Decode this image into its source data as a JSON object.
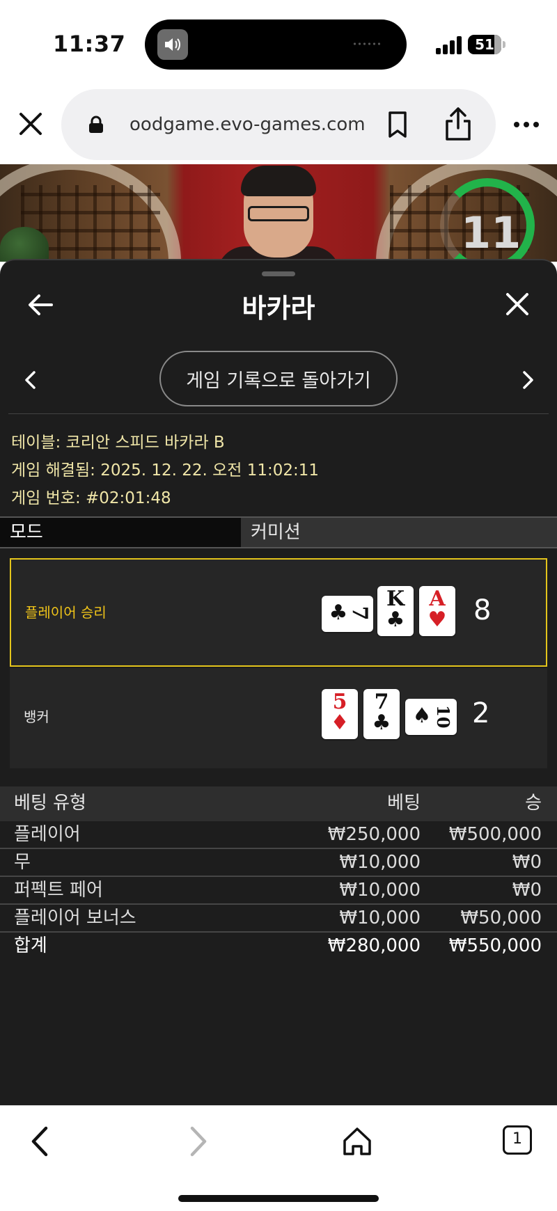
{
  "status_bar": {
    "time": "11:37",
    "battery": "51"
  },
  "browser": {
    "url": "oodgame.evo-games.com"
  },
  "video": {
    "timer": "11"
  },
  "sheet": {
    "title": "바카라",
    "history_button": "게임 기록으로 돌아가기",
    "info": {
      "table_label": "테이블:",
      "table_value": "코리안 스피드 바카라 B",
      "resolved_label": "게임 해결됨:",
      "resolved_value": "2025. 12. 22. 오전 11:02:11",
      "game_no_label": "게임 번호:",
      "game_no_value": "#02:01:48"
    },
    "mode": {
      "label": "모드",
      "value": "커미션"
    },
    "player": {
      "label": "플레이어 승리",
      "score": "8",
      "cards": [
        {
          "rank": "7",
          "suit": "♣",
          "color": "black",
          "orientation": "sideways"
        },
        {
          "rank": "K",
          "suit": "♣",
          "color": "black",
          "orientation": "upright"
        },
        {
          "rank": "A",
          "suit": "♥",
          "color": "red",
          "orientation": "upright"
        }
      ]
    },
    "banker": {
      "label": "뱅커",
      "score": "2",
      "cards": [
        {
          "rank": "5",
          "suit": "♦",
          "color": "red",
          "orientation": "upright"
        },
        {
          "rank": "7",
          "suit": "♣",
          "color": "black",
          "orientation": "upright"
        },
        {
          "rank": "10",
          "suit": "♠",
          "color": "black",
          "orientation": "sideways"
        }
      ]
    },
    "bets": {
      "headers": {
        "type": "베팅 유형",
        "bet": "베팅",
        "win": "승"
      },
      "rows": [
        {
          "type": "플레이어",
          "bet": "₩250,000",
          "win": "₩500,000"
        },
        {
          "type": "무",
          "bet": "₩10,000",
          "win": "₩0"
        },
        {
          "type": "퍼펙트 페어",
          "bet": "₩10,000",
          "win": "₩0"
        },
        {
          "type": "플레이어 보너스",
          "bet": "₩10,000",
          "win": "₩50,000"
        }
      ],
      "total": {
        "type": "합계",
        "bet": "₩280,000",
        "win": "₩550,000"
      }
    }
  },
  "toolbar": {
    "tab_count": "1"
  },
  "colors": {
    "win_highlight": "#e4c51b",
    "info_text": "#f0e6a8",
    "timer_ring": "#22b34a",
    "sheet_bg": "#1d1d1d"
  }
}
